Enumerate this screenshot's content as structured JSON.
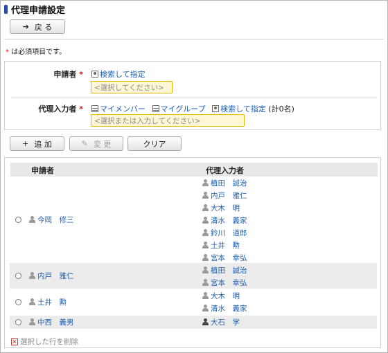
{
  "page": {
    "title": "代理申請設定",
    "back_label": "戻 る",
    "required_note": " は必須項目です。",
    "required_mark": "*"
  },
  "form": {
    "applicant": {
      "label": "申請者",
      "search_link": "検索して指定",
      "placeholder": "<選択してください>"
    },
    "proxy": {
      "label": "代理入力者",
      "my_members": "マイメンバー",
      "my_groups": "マイグループ",
      "search_link": "検索して指定",
      "count": "(計0名)",
      "placeholder": "<選択または入力してください>"
    }
  },
  "actions": {
    "add": "追 加",
    "change": "変 更",
    "clear": "クリア"
  },
  "table": {
    "headers": [
      "申請者",
      "代理入力者"
    ],
    "rows": [
      {
        "applicant": "今岡　修三",
        "proxies": [
          "植田　誠治",
          "内戸　雅仁",
          "大木　明",
          "清水　義家",
          "鈴川　道郎",
          "土井　勲",
          "宮本　幸弘"
        ]
      },
      {
        "applicant": "内戸　雅仁",
        "proxies": [
          "植田　誠治",
          "宮本　幸弘"
        ]
      },
      {
        "applicant": "土井　勲",
        "proxies": [
          "大木　明",
          "清水　義家"
        ]
      },
      {
        "applicant": "中西　義男",
        "proxies": [
          "大石　学"
        ]
      }
    ],
    "delete_label": "選択した行を削除"
  },
  "colors": {
    "link": "#1b5fb5",
    "required": "#dd1111",
    "highlight_border": "#e6b800",
    "highlight_bg": "#fff7d6"
  }
}
